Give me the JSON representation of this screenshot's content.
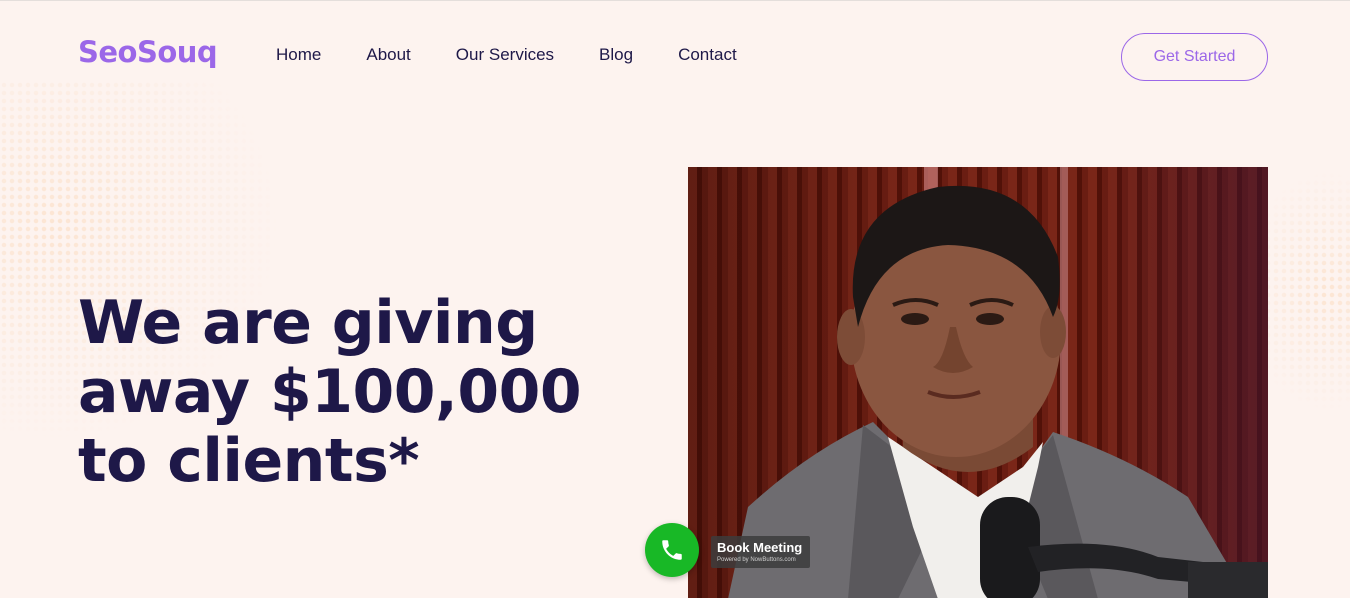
{
  "brand": {
    "name": "SeoSouq",
    "accent": "#9b67e8"
  },
  "nav": {
    "items": [
      {
        "label": "Home"
      },
      {
        "label": "About"
      },
      {
        "label": "Our Services"
      },
      {
        "label": "Blog"
      },
      {
        "label": "Contact"
      }
    ]
  },
  "cta": {
    "label": "Get Started"
  },
  "hero": {
    "headline": "We are giving away $100,000 to clients*"
  },
  "widget": {
    "title": "Book Meeting",
    "subtitle": "Powered by NowButtons.com",
    "icon": "phone-icon",
    "color": "#18b826"
  },
  "colors": {
    "background": "#fdf3ef",
    "heading": "#1e1848"
  }
}
